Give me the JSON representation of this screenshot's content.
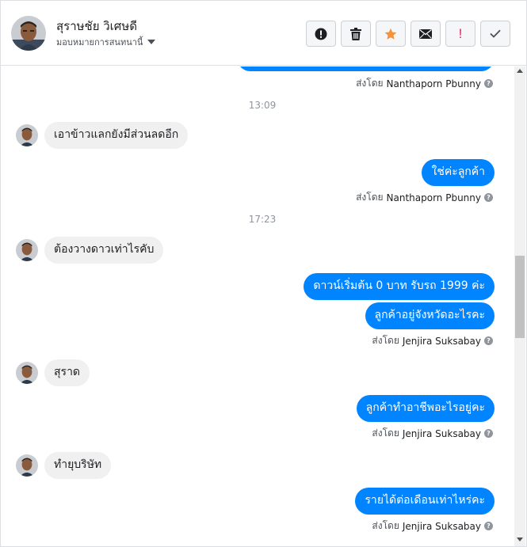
{
  "colors": {
    "outgoing_bubble": "#0084ff",
    "incoming_bubble": "#f1f0f0",
    "star": "#f7923b",
    "alert": "#e0245e"
  },
  "header": {
    "name": "สุราษชัย วิเศษดี",
    "assign_label": "มอบหมายการสนทนานี้",
    "actions": [
      {
        "icon": "info-alert-icon"
      },
      {
        "icon": "trash-icon"
      },
      {
        "icon": "star-icon"
      },
      {
        "icon": "envelope-icon"
      },
      {
        "icon": "exclamation-icon",
        "text": "!"
      },
      {
        "icon": "checkmark-icon"
      }
    ]
  },
  "thread": {
    "top_sent_by": {
      "prefix": "ส่งโดย",
      "name": "Nanthaporn Pbunny"
    },
    "timestamps": [
      "13:09",
      "17:23"
    ],
    "messages": [
      {
        "side": "in",
        "text": "เอาข้าวแลกยังมีส่วนลดอีก"
      },
      {
        "side": "out",
        "text": "ใช่ค่ะลูกค้า",
        "sent_by_prefix": "ส่งโดย",
        "sent_by": "Nanthaporn Pbunny"
      },
      {
        "side": "in",
        "text": "ต้องวางดาวเท่าไรคับ"
      },
      {
        "side": "out",
        "text": "ดาวน์เริ่มต้น 0 บาท รับรถ 1999 ค่ะ"
      },
      {
        "side": "out",
        "text": "ลูกค้าอยู่จังหวัดอะไรคะ",
        "sent_by_prefix": "ส่งโดย",
        "sent_by": "Jenjira Suksabay"
      },
      {
        "side": "in",
        "text": "สุราด"
      },
      {
        "side": "out",
        "text": "ลูกค้าทำอาชีพอะไรอยู่คะ",
        "sent_by_prefix": "ส่งโดย",
        "sent_by": "Jenjira Suksabay"
      },
      {
        "side": "in",
        "text": "ทำยุบริษัท"
      },
      {
        "side": "out",
        "text": "รายได้ต่อเดือนเท่าไหร่คะ",
        "sent_by_prefix": "ส่งโดย",
        "sent_by": "Jenjira Suksabay"
      }
    ]
  }
}
